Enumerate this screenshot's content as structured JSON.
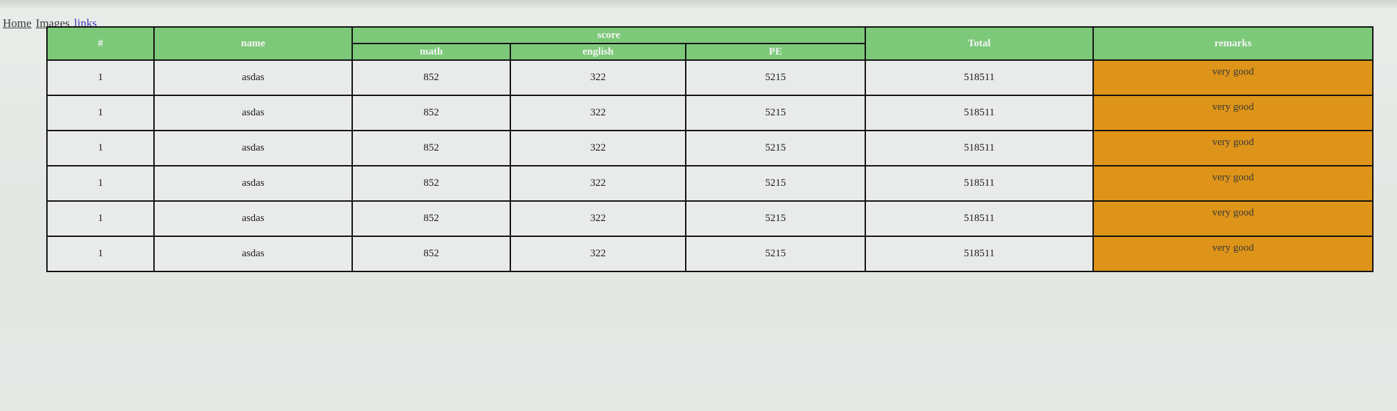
{
  "nav": {
    "links": [
      "Home",
      "Images",
      "links"
    ]
  },
  "table": {
    "headers": {
      "index": "#",
      "name": "name",
      "score": "score",
      "math": "math",
      "english": "english",
      "pe": "PE",
      "total": "Total",
      "remarks": "remarks"
    },
    "rows": [
      {
        "index": "1",
        "name": "asdas",
        "math": "852",
        "english": "322",
        "pe": "5215",
        "total": "518511",
        "remarks": "very good"
      },
      {
        "index": "1",
        "name": "asdas",
        "math": "852",
        "english": "322",
        "pe": "5215",
        "total": "518511",
        "remarks": "very good"
      },
      {
        "index": "1",
        "name": "asdas",
        "math": "852",
        "english": "322",
        "pe": "5215",
        "total": "518511",
        "remarks": "very good"
      },
      {
        "index": "1",
        "name": "asdas",
        "math": "852",
        "english": "322",
        "pe": "5215",
        "total": "518511",
        "remarks": "very good"
      },
      {
        "index": "1",
        "name": "asdas",
        "math": "852",
        "english": "322",
        "pe": "5215",
        "total": "518511",
        "remarks": "very good"
      },
      {
        "index": "1",
        "name": "asdas",
        "math": "852",
        "english": "322",
        "pe": "5215",
        "total": "518511",
        "remarks": "very good"
      }
    ]
  },
  "colors": {
    "header_bg": "#7dc97a",
    "remark_bg": "#de9418",
    "cell_bg": "#e8ebe9",
    "border": "#111111"
  }
}
